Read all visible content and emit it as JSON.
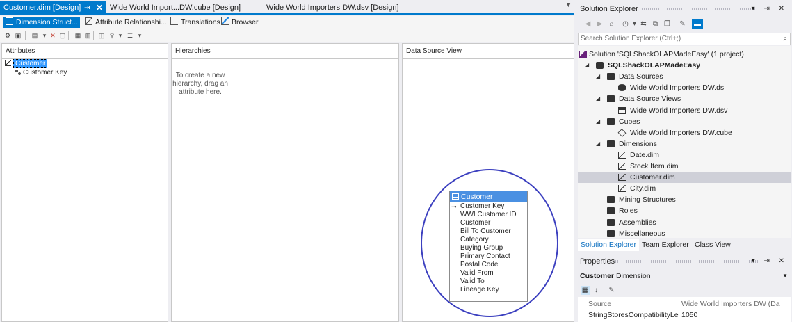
{
  "doc_tabs": {
    "active": {
      "label": "Customer.dim [Design]",
      "pin": "⇥",
      "close": "✕"
    },
    "tab2": "Wide World Import...DW.cube [Design]",
    "tab3": "Wide World Importers DW.dsv [Design]",
    "dropdown": "▼"
  },
  "designer_tabs": [
    "Dimension Struct...",
    "Attribute Relationshi...",
    "Translations",
    "Browser"
  ],
  "panes": {
    "attributes": "Attributes",
    "hierarchies": "Hierarchies",
    "dsv": "Data Source View"
  },
  "attributes_tree": {
    "dimension": "Customer",
    "attribute": "Customer Key"
  },
  "hierarchy_hint": "To create a new hierarchy, drag an attribute here.",
  "dsv_table": {
    "name": "Customer",
    "columns": [
      "Customer Key",
      "WWI Customer ID",
      "Customer",
      "Bill To Customer",
      "Category",
      "Buying Group",
      "Primary Contact",
      "Postal Code",
      "Valid From",
      "Valid To",
      "Lineage Key"
    ]
  },
  "solution_explorer": {
    "title": "Solution Explorer",
    "title_buttons": "▾ ⇥ ✕",
    "search_placeholder": "Search Solution Explorer (Ctrl+;)",
    "search_icon": "⌕",
    "tree": [
      {
        "label": "Solution 'SQLShackOLAPMadeEasy' (1 project)",
        "icon": "solution-icon"
      },
      {
        "label": "SQLShackOLAPMadeEasy",
        "icon": "project-icon",
        "bold": true
      },
      {
        "label": "Data Sources",
        "icon": "folder-icon"
      },
      {
        "label": "Wide World Importers DW.ds",
        "icon": "data-source-icon"
      },
      {
        "label": "Data Source Views",
        "icon": "folder-icon"
      },
      {
        "label": "Wide World Importers DW.dsv",
        "icon": "dsv-icon"
      },
      {
        "label": "Cubes",
        "icon": "folder-icon"
      },
      {
        "label": "Wide World Importers DW.cube",
        "icon": "cube-icon"
      },
      {
        "label": "Dimensions",
        "icon": "folder-icon"
      },
      {
        "label": "Date.dim",
        "icon": "dimension-icon"
      },
      {
        "label": "Stock Item.dim",
        "icon": "dimension-icon"
      },
      {
        "label": "Customer.dim",
        "icon": "dimension-icon",
        "selected": true
      },
      {
        "label": "City.dim",
        "icon": "dimension-icon"
      },
      {
        "label": "Mining Structures",
        "icon": "folder-icon"
      },
      {
        "label": "Roles",
        "icon": "folder-icon"
      },
      {
        "label": "Assemblies",
        "icon": "folder-icon"
      },
      {
        "label": "Miscellaneous",
        "icon": "folder-icon"
      }
    ],
    "bottom_tabs": [
      "Solution Explorer",
      "Team Explorer",
      "Class View"
    ]
  },
  "properties": {
    "title": "Properties",
    "title_buttons": "▾ ⇥ ✕",
    "object_name": "Customer",
    "object_type": "Dimension",
    "dropdown": "▼",
    "rows": [
      {
        "name": "Source",
        "value": "Wide World Importers DW (Da"
      },
      {
        "name": "StringStoresCompatibilityLe",
        "value": "1050"
      }
    ]
  },
  "colors": {
    "accent": "#007acc",
    "circle": "#3b3fbf",
    "table_header": "#4a90e2"
  }
}
